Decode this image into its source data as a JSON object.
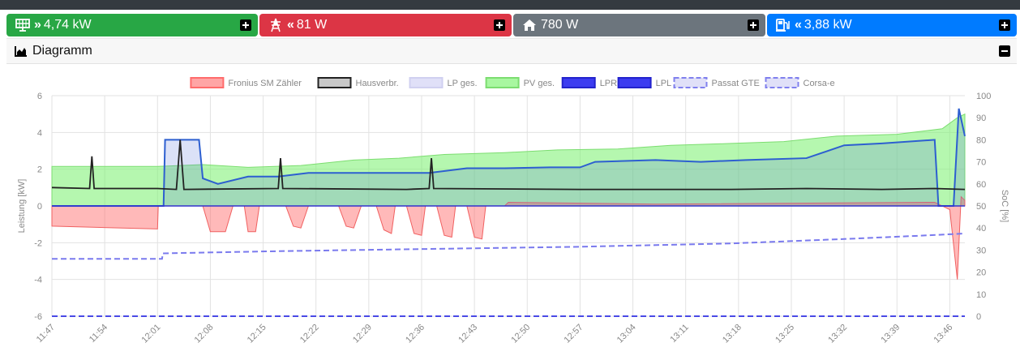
{
  "tiles": [
    {
      "label": "4,74 kW",
      "color": "#28a745",
      "icon": "solar-panel-icon",
      "direction": "in"
    },
    {
      "label": "81 W",
      "color": "#dc3545",
      "icon": "grid-tower-icon",
      "direction": "out"
    },
    {
      "label": "780 W",
      "color": "#6c757d",
      "icon": "home-icon",
      "direction": ""
    },
    {
      "label": "3,88 kW",
      "color": "#007bff",
      "icon": "charging-station-icon",
      "direction": "out"
    }
  ],
  "diagram": {
    "title": "Diagramm"
  },
  "chart_data": {
    "type": "area",
    "legend_position": "top",
    "legend": [
      {
        "name": "Fronius SM Zähler",
        "fill": "#ffa5a5",
        "stroke": "#ff6b6b",
        "dashed": false
      },
      {
        "name": "Hausverbr.",
        "fill": "#c8c8c8",
        "stroke": "#222222",
        "dashed": false
      },
      {
        "name": "LP ges.",
        "fill": "#e0e0f8",
        "stroke": "#d0d0f0",
        "dashed": false
      },
      {
        "name": "PV ges.",
        "fill": "#a8f7a0",
        "stroke": "#7cdd70",
        "dashed": false
      },
      {
        "name": "LPR",
        "fill": "#3c3cf0",
        "stroke": "#2222cc",
        "dashed": false
      },
      {
        "name": "LPL",
        "fill": "#3c3cf0",
        "stroke": "#2222cc",
        "dashed": false
      },
      {
        "name": "Passat GTE",
        "fill": "#e0e0f8",
        "stroke": "#8080ee",
        "dashed": true
      },
      {
        "name": "Corsa-e",
        "fill": "#e0e0f8",
        "stroke": "#8080ee",
        "dashed": true
      }
    ],
    "ylabel_left": "Leistung [kW]",
    "ylabel_right": "SoC [%]",
    "ylim_left": [
      -6,
      6
    ],
    "ylim_right": [
      0,
      100
    ],
    "yticks_left": [
      "6",
      "4",
      "2",
      "0",
      "-2",
      "-4",
      "-6"
    ],
    "yticks_right": [
      "100",
      "90",
      "80",
      "70",
      "60",
      "50",
      "40",
      "30",
      "20",
      "10",
      "0"
    ],
    "x_tick_labels": [
      "11:47",
      "11:54",
      "12:01",
      "12:08",
      "12:15",
      "12:22",
      "12:29",
      "12:36",
      "12:43",
      "12:50",
      "12:57",
      "13:04",
      "13:11",
      "13:18",
      "13:25",
      "13:32",
      "13:39",
      "13:46"
    ],
    "x_range_minutes": [
      0,
      121
    ],
    "grid": true,
    "series": [
      {
        "name": "PV ges.",
        "unit": "kW",
        "points": [
          [
            0,
            2.15
          ],
          [
            14,
            2.15
          ],
          [
            20,
            2.25
          ],
          [
            26,
            2.1
          ],
          [
            33,
            2.2
          ],
          [
            40,
            2.5
          ],
          [
            46,
            2.6
          ],
          [
            52,
            2.8
          ],
          [
            60,
            2.9
          ],
          [
            67,
            3.05
          ],
          [
            75,
            3.1
          ],
          [
            82,
            3.3
          ],
          [
            90,
            3.4
          ],
          [
            97,
            3.5
          ],
          [
            104,
            3.8
          ],
          [
            112,
            3.9
          ],
          [
            118,
            4.2
          ],
          [
            120,
            4.8
          ],
          [
            121,
            5.0
          ]
        ]
      },
      {
        "name": "Fronius SM Zähler",
        "unit": "kW",
        "points": [
          [
            0,
            -1.1
          ],
          [
            14,
            -1.25
          ],
          [
            14.1,
            0
          ],
          [
            20,
            0
          ],
          [
            21,
            -1.4
          ],
          [
            23,
            -1.4
          ],
          [
            24,
            0
          ],
          [
            25.5,
            0
          ],
          [
            26,
            -1.4
          ],
          [
            27,
            -1.4
          ],
          [
            27.5,
            0
          ],
          [
            31,
            0
          ],
          [
            32,
            -1.1
          ],
          [
            33,
            -1.2
          ],
          [
            34,
            0
          ],
          [
            38,
            0
          ],
          [
            39,
            -1.1
          ],
          [
            40,
            -1.2
          ],
          [
            41,
            0
          ],
          [
            43,
            0
          ],
          [
            44,
            -1.3
          ],
          [
            45,
            -1.5
          ],
          [
            45.5,
            0
          ],
          [
            47,
            0
          ],
          [
            48,
            -1.5
          ],
          [
            49,
            -1.6
          ],
          [
            49.5,
            0
          ],
          [
            51,
            0
          ],
          [
            52,
            -1.6
          ],
          [
            53,
            -1.7
          ],
          [
            53.5,
            0
          ],
          [
            55,
            0
          ],
          [
            56,
            -1.7
          ],
          [
            57,
            -1.8
          ],
          [
            57.5,
            0
          ],
          [
            60,
            0
          ],
          [
            60.5,
            0.2
          ],
          [
            80,
            0.1
          ],
          [
            117,
            0.2
          ],
          [
            119,
            -0.2
          ],
          [
            120,
            -4.0
          ],
          [
            120.5,
            0.5
          ],
          [
            121,
            0.3
          ]
        ]
      },
      {
        "name": "Hausverbr.",
        "unit": "kW",
        "points": [
          [
            0,
            1.0
          ],
          [
            5,
            0.95
          ],
          [
            5.3,
            2.7
          ],
          [
            5.6,
            0.95
          ],
          [
            14,
            0.95
          ],
          [
            16.5,
            0.9
          ],
          [
            17,
            3.6
          ],
          [
            17.5,
            0.9
          ],
          [
            30,
            0.95
          ],
          [
            30.3,
            2.6
          ],
          [
            30.6,
            0.95
          ],
          [
            47,
            0.9
          ],
          [
            50,
            0.95
          ],
          [
            50.3,
            2.6
          ],
          [
            50.6,
            0.95
          ],
          [
            70,
            0.9
          ],
          [
            90,
            0.9
          ],
          [
            100,
            0.95
          ],
          [
            110,
            0.9
          ],
          [
            117,
            0.95
          ],
          [
            121,
            0.9
          ]
        ]
      },
      {
        "name": "LPR",
        "unit": "kW",
        "points": [
          [
            0,
            0
          ],
          [
            14.8,
            0
          ],
          [
            15,
            3.6
          ],
          [
            19.5,
            3.6
          ],
          [
            20,
            1.5
          ],
          [
            22,
            1.2
          ],
          [
            26,
            1.6
          ],
          [
            30,
            1.6
          ],
          [
            34,
            1.8
          ],
          [
            40,
            1.8
          ],
          [
            46,
            1.8
          ],
          [
            50,
            1.8
          ],
          [
            55,
            2.05
          ],
          [
            60,
            2.05
          ],
          [
            66,
            2.1
          ],
          [
            70,
            2.1
          ],
          [
            72,
            2.4
          ],
          [
            80,
            2.5
          ],
          [
            86,
            2.4
          ],
          [
            92,
            2.5
          ],
          [
            100,
            2.6
          ],
          [
            105,
            3.3
          ],
          [
            110,
            3.4
          ],
          [
            117,
            3.6
          ],
          [
            117.5,
            0
          ],
          [
            119.5,
            0
          ],
          [
            120.2,
            5.3
          ],
          [
            121,
            3.8
          ]
        ]
      },
      {
        "name": "Passat GTE",
        "unit": "%",
        "points": [
          [
            0,
            26
          ],
          [
            14.6,
            26
          ],
          [
            14.7,
            28.5
          ],
          [
            30,
            29.5
          ],
          [
            50,
            30.5
          ],
          [
            70,
            31.5
          ],
          [
            90,
            33
          ],
          [
            105,
            35
          ],
          [
            115,
            36.5
          ],
          [
            121,
            37.5
          ]
        ]
      },
      {
        "name": "Corsa-e",
        "unit": "%",
        "points": [
          [
            0,
            0
          ],
          [
            121,
            0
          ]
        ]
      }
    ]
  }
}
